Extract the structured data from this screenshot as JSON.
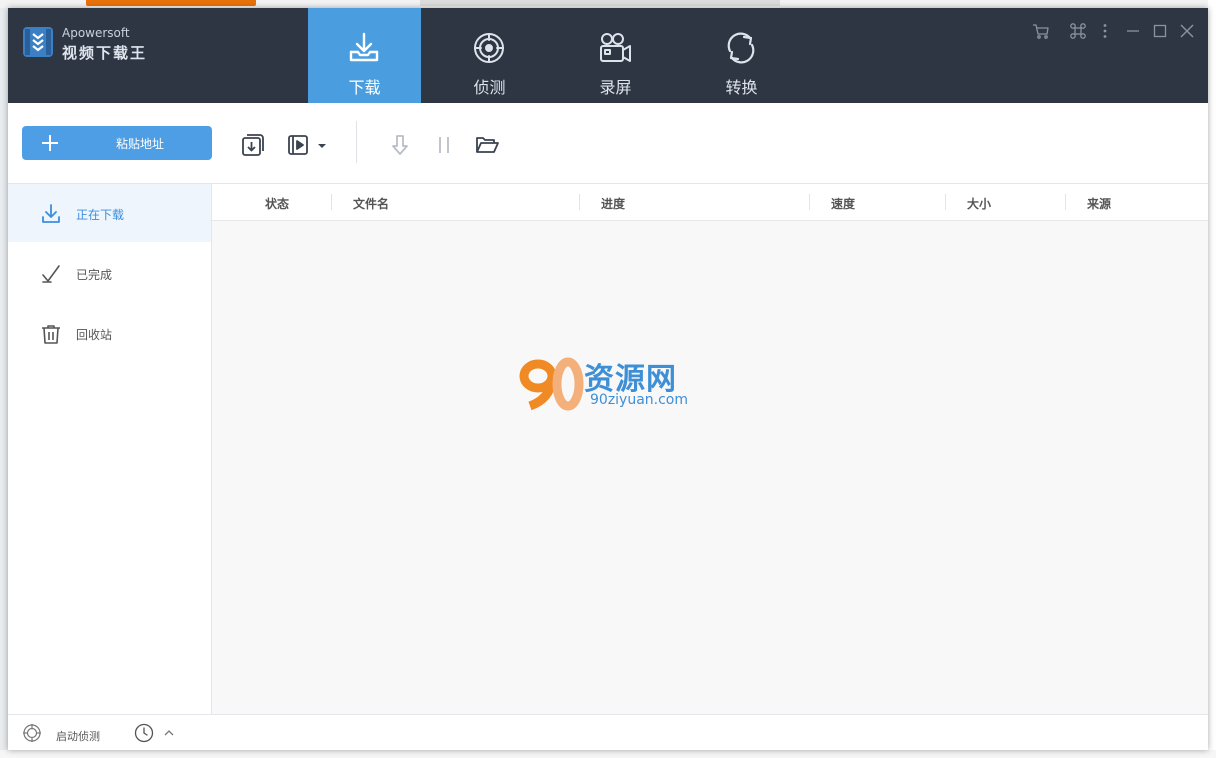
{
  "app": {
    "brand_en": "Apowersoft",
    "brand_cn": "视频下载王"
  },
  "nav": [
    {
      "label": "下载",
      "icon": "download-tray-icon",
      "active": true
    },
    {
      "label": "侦测",
      "icon": "radar-target-icon",
      "active": false
    },
    {
      "label": "录屏",
      "icon": "video-camera-icon",
      "active": false
    },
    {
      "label": "转换",
      "icon": "convert-cycle-icon",
      "active": false
    }
  ],
  "window_controls": [
    "cart-icon",
    "command-icon",
    "more-vertical-icon",
    "minimize-icon",
    "maximize-icon",
    "close-icon"
  ],
  "toolbar": {
    "paste_label": "粘贴地址",
    "icons": [
      "batch-download-icon",
      "video-list-icon",
      "dropdown-arrow-icon",
      "start-download-icon",
      "pause-icon",
      "open-folder-icon"
    ]
  },
  "sidebar": {
    "items": [
      {
        "label": "正在下载",
        "icon": "download-icon",
        "active": true
      },
      {
        "label": "已完成",
        "icon": "check-done-icon",
        "active": false
      },
      {
        "label": "回收站",
        "icon": "trash-icon",
        "active": false
      }
    ]
  },
  "table": {
    "columns": [
      "状态",
      "文件名",
      "进度",
      "速度",
      "大小",
      "来源"
    ]
  },
  "watermark": {
    "text": "资源网",
    "sub": "90ziyuan.com"
  },
  "status": {
    "detect_label": "启动侦测"
  },
  "colors": {
    "header_bg": "#2e3644",
    "accent": "#4a9ee0",
    "paste_button": "#4e9ee6"
  }
}
